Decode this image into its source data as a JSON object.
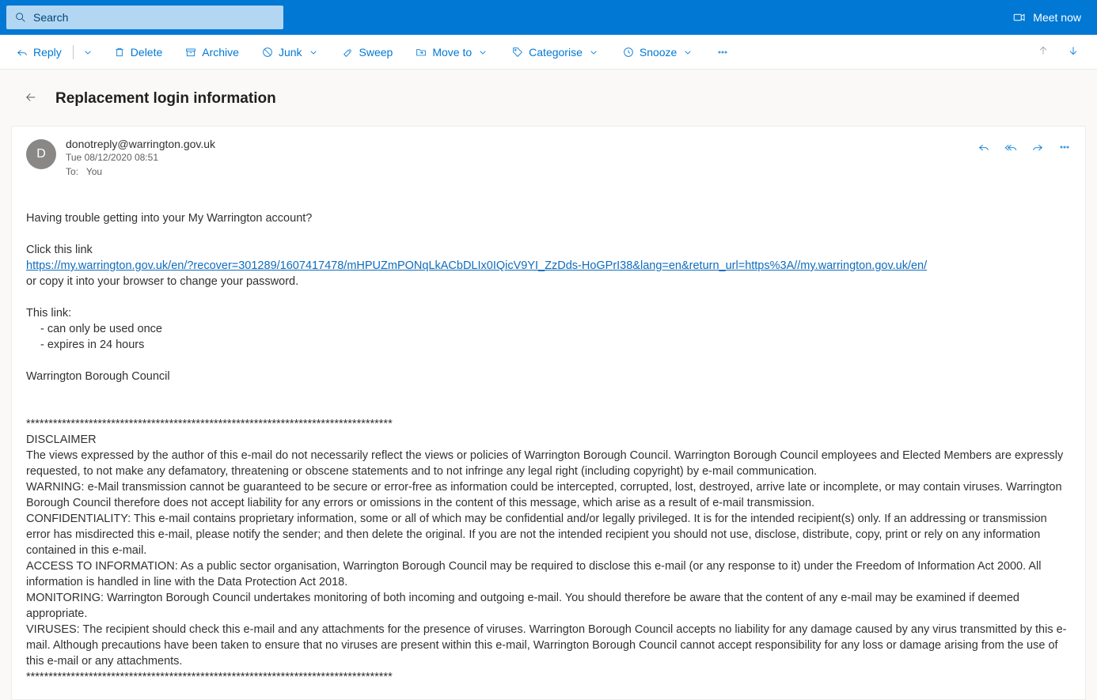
{
  "header": {
    "search_placeholder": "Search",
    "meet_now": "Meet now"
  },
  "toolbar": {
    "reply": "Reply",
    "delete": "Delete",
    "archive": "Archive",
    "junk": "Junk",
    "sweep": "Sweep",
    "move_to": "Move to",
    "categorise": "Categorise",
    "snooze": "Snooze"
  },
  "subject": "Replacement login information",
  "message": {
    "avatar_initial": "D",
    "from": "donotreply@warrington.gov.uk",
    "date": "Tue 08/12/2020 08:51",
    "to_label": "To:",
    "to_value": "You"
  },
  "body": {
    "p1": "Having trouble getting into your My Warrington account?",
    "p2": "Click this link",
    "link": "https://my.warrington.gov.uk/en/?recover=301289/1607417478/mHPUZmPONqLkACbDLIx0IQicV9YI_ZzDds-HoGPrI38&lang=en&return_url=https%3A//my.warrington.gov.uk/en/",
    "p3": "or copy it into your browser to change your password.",
    "p4": "This link:",
    "b1": "- can only be used once",
    "b2": "- expires in 24 hours",
    "p5": "Warrington Borough Council",
    "stars": "**********************************************************************************",
    "d_head": "DISCLAIMER",
    "d1": "The views expressed by the author of this e-mail do not necessarily reflect the views or policies of Warrington Borough Council.  Warrington Borough Council employees and Elected Members are expressly requested, to not make any defamatory, threatening or obscene statements and to not infringe any legal right (including copyright) by e-mail communication.",
    "d2": "WARNING: e-Mail transmission cannot be guaranteed to be secure or error-free as information could be intercepted, corrupted, lost, destroyed, arrive late or incomplete, or may contain viruses.  Warrington Borough Council therefore does not accept liability for any errors or omissions in the content of this message, which arise as a result of e-mail transmission.",
    "d3": "CONFIDENTIALITY: This e-mail contains proprietary information, some or all of which may be confidential and/or legally privileged.  It is for the intended recipient(s) only.  If an addressing or transmission error has misdirected this e-mail, please notify the sender; and then delete the original.  If you are not the intended recipient you should not use, disclose, distribute, copy, print or rely on any information contained in this e-mail.",
    "d4": "ACCESS TO INFORMATION: As a public sector organisation, Warrington Borough Council may be required to disclose this e-mail (or any response to it) under the Freedom of Information Act 2000.  All information is handled in line with the Data Protection Act 2018.",
    "d5": "MONITORING: Warrington Borough Council undertakes monitoring of both incoming and outgoing e-mail.  You should therefore be aware that the content of any e-mail may be examined if deemed appropriate.",
    "d6": "VIRUSES: The recipient should check this e-mail and any attachments for the presence of viruses.  Warrington Borough Council accepts no liability for any damage caused by any virus transmitted by this e-mail.  Although precautions have been taken to ensure that no viruses are present within this e-mail, Warrington Borough Council cannot accept responsibility for any loss or damage arising from the use of this e-mail or any attachments.",
    "stars2": "**********************************************************************************"
  }
}
